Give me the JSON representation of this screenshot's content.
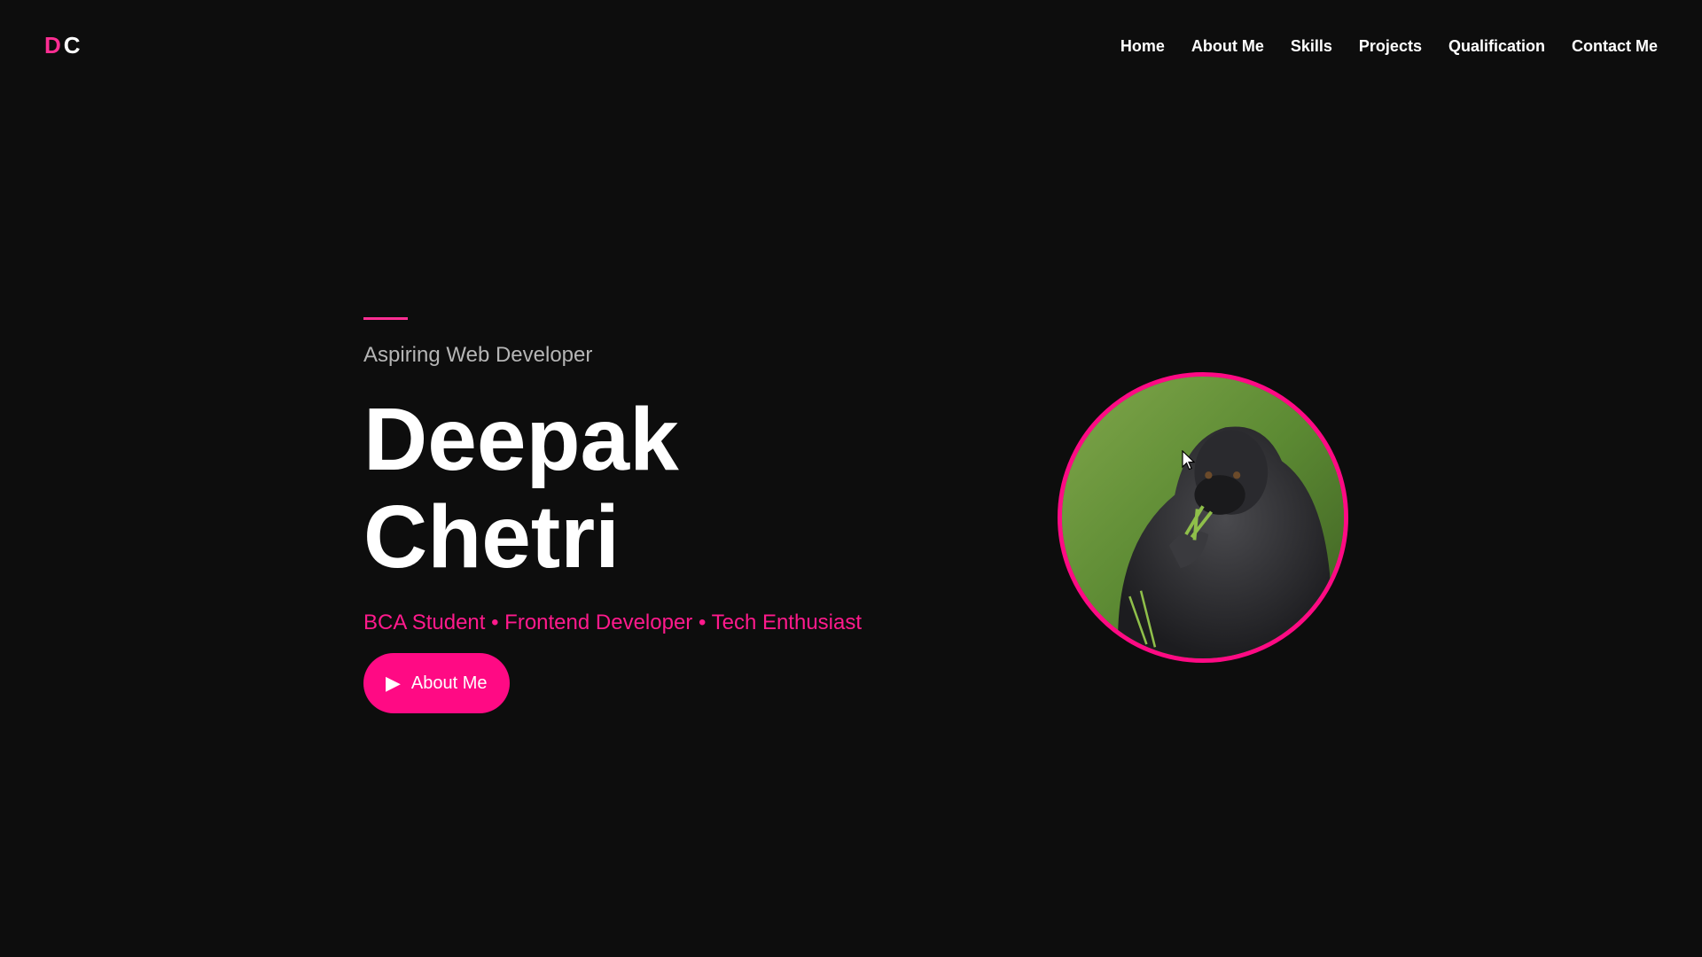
{
  "logo": {
    "first": "D",
    "second": "C"
  },
  "nav": {
    "items": [
      "Home",
      "About Me",
      "Skills",
      "Projects",
      "Qualification",
      "Contact Me"
    ]
  },
  "hero": {
    "tagline": "Aspiring Web Developer",
    "first_name": "Deepak",
    "last_name": "Chetri",
    "roles": "BCA Student • Frontend Developer • Tech Enthusiast",
    "cta_label": "About Me",
    "cta_icon": "play-icon"
  },
  "avatar": {
    "subject": "gorilla-photo"
  },
  "colors": {
    "background": "#0d0d0d",
    "accent": "#ff0a84",
    "text": "#ffffff",
    "muted": "#b5b5b5"
  }
}
